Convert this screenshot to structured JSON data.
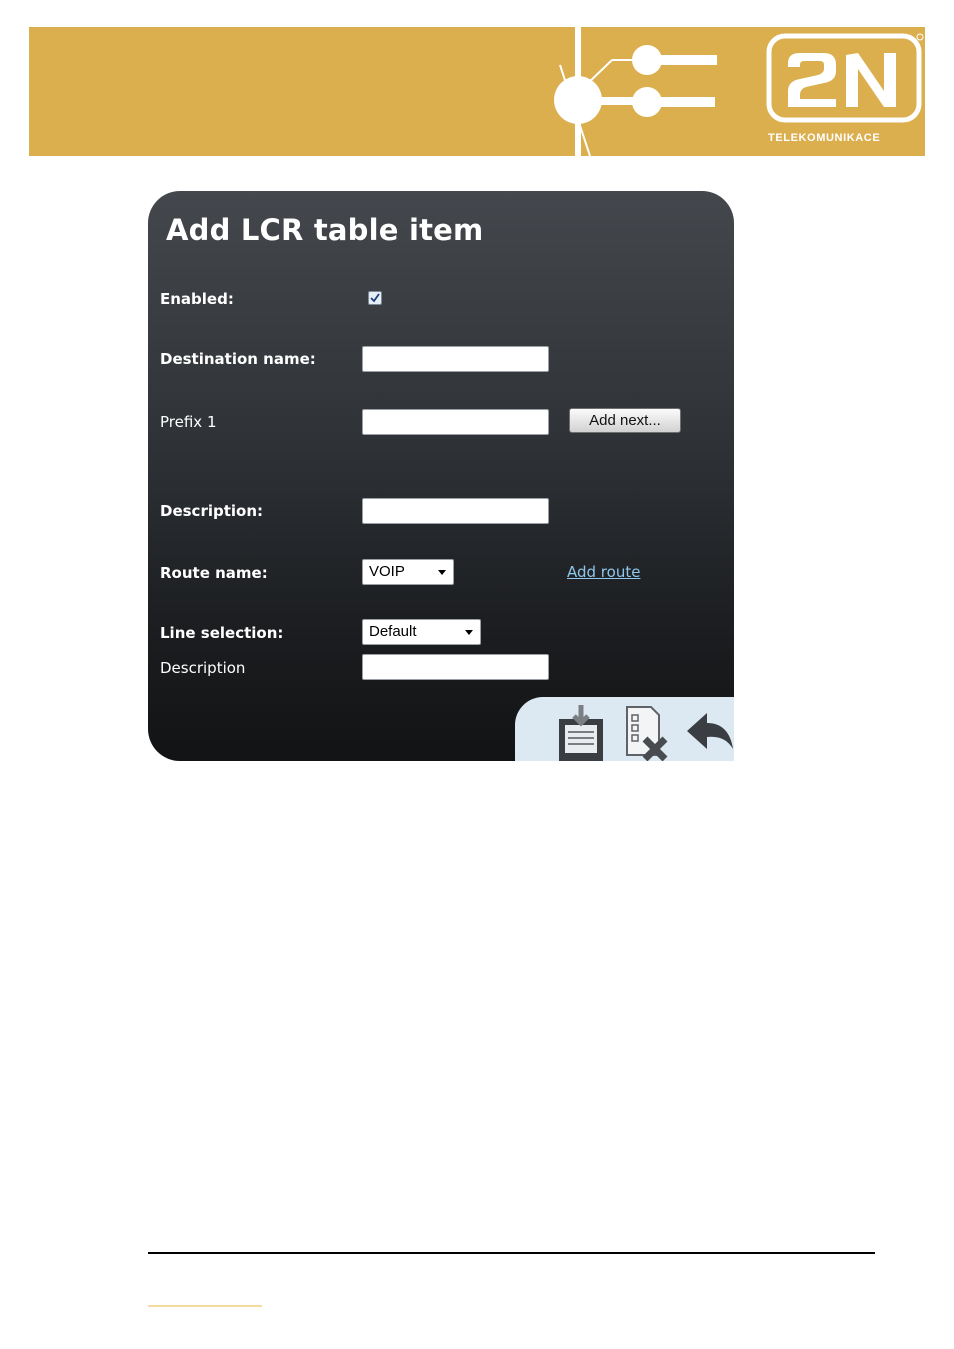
{
  "header": {
    "brand_color": "#dbae4e",
    "logo": {
      "mark": "2N",
      "subtitle": "TELEKOMUNIKACE"
    }
  },
  "dialog": {
    "title": "Add LCR table item",
    "fields": {
      "enabled": {
        "label": "Enabled:",
        "checked": true
      },
      "destination_name": {
        "label": "Destination name:",
        "value": ""
      },
      "prefix": {
        "label": "Prefix 1",
        "value": "",
        "add_next_label": "Add next..."
      },
      "description": {
        "label": "Description:",
        "value": ""
      },
      "route_name": {
        "label": "Route name:",
        "selected": "VOIP",
        "add_route_label": "Add route"
      },
      "line_selection": {
        "label": "Line selection:",
        "selected": "Default"
      },
      "line_description": {
        "label": "Description",
        "value": ""
      }
    },
    "toolbar": {
      "icons": [
        "save-icon",
        "delete-icon",
        "back-icon"
      ]
    },
    "colors": {
      "panel_top": "#44484d",
      "panel_bottom": "#121314",
      "link": "#8fc7ec",
      "toolbar_bg": "#dce8f2"
    }
  }
}
